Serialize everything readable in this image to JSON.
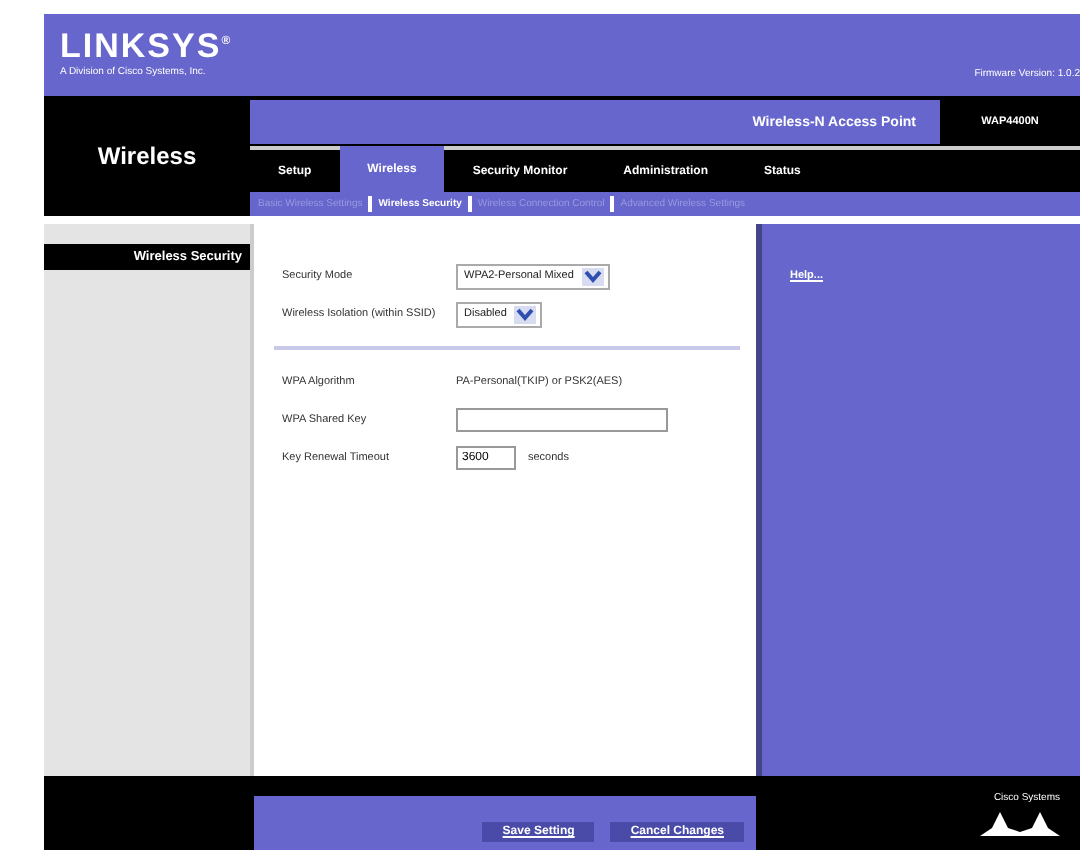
{
  "header": {
    "logo": "LINKSYS",
    "logo_mark": "®",
    "tagline": "A Division of Cisco Systems, Inc.",
    "firmware": "Firmware Version: 1.0.2"
  },
  "section_title": "Wireless",
  "product_name": "Wireless-N Access Point",
  "model": "WAP4400N",
  "tabs": [
    {
      "label": "Setup",
      "selected": false
    },
    {
      "label": "Wireless",
      "selected": true
    },
    {
      "label": "Security Monitor",
      "selected": false
    },
    {
      "label": "Administration",
      "selected": false
    },
    {
      "label": "Status",
      "selected": false
    }
  ],
  "subtabs": [
    {
      "label": "Basic Wireless Settings",
      "selected": false
    },
    {
      "label": "Wireless Security",
      "selected": true
    },
    {
      "label": "Wireless Connection Control",
      "selected": false
    },
    {
      "label": "Advanced Wireless Settings",
      "selected": false
    }
  ],
  "sidebar_heading": "Wireless Security",
  "form": [
    {
      "kind": "select",
      "label": "Security Mode",
      "value": "WPA2-Personal Mixed"
    },
    {
      "kind": "select",
      "label": "Wireless Isolation (within SSID)",
      "value": "Disabled"
    },
    {
      "kind": "divider"
    },
    {
      "kind": "text",
      "label": "WPA Algorithm",
      "value": "PA-Personal(TKIP) or PSK2(AES)"
    },
    {
      "kind": "input",
      "label": "WPA Shared Key"
    },
    {
      "kind": "input_unit",
      "label": "Key Renewal Timeout",
      "value": "3600",
      "unit": "seconds"
    }
  ],
  "help_link": "Help...",
  "buttons": [
    "Save Setting",
    "Cancel Changes"
  ],
  "footer_logo": "Cisco Systems"
}
